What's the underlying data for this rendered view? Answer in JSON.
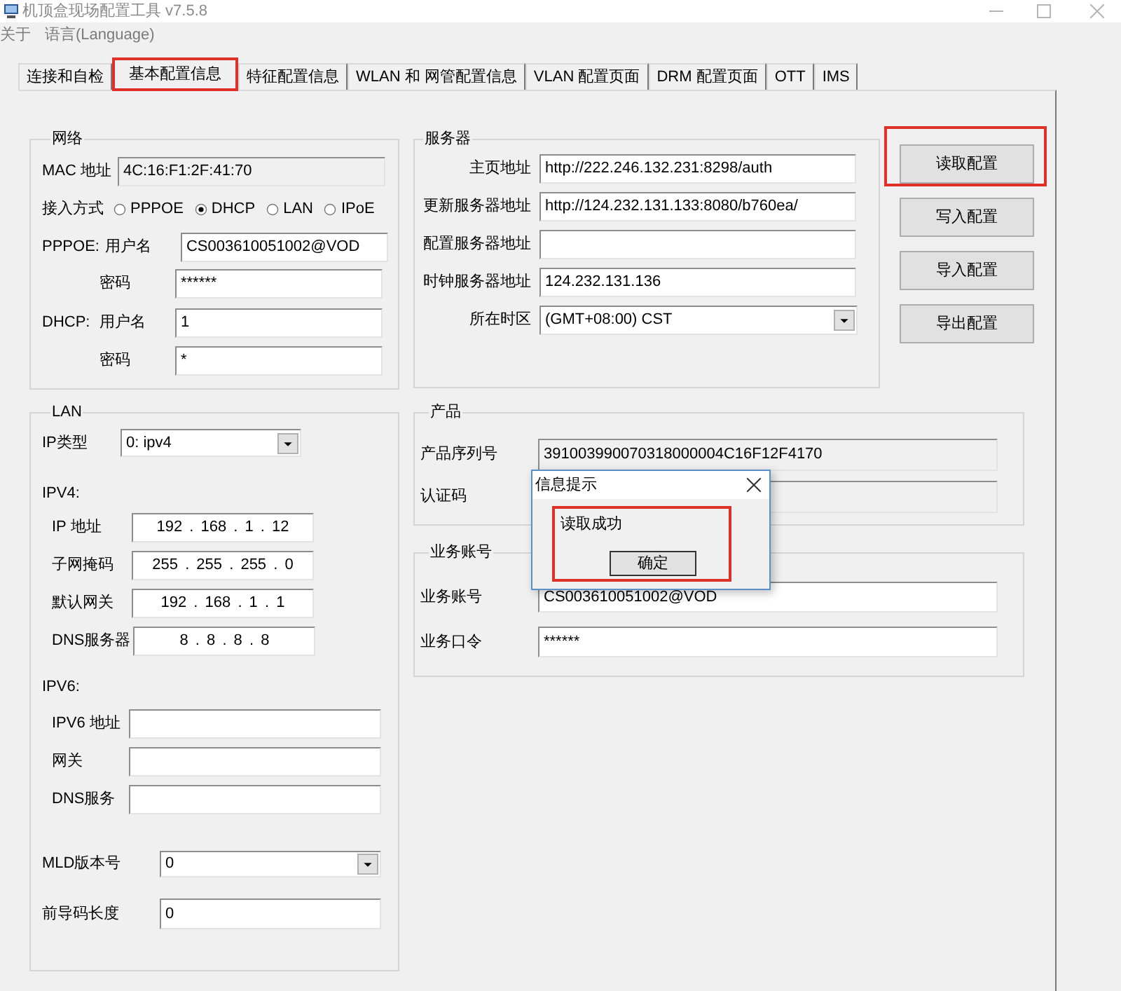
{
  "window": {
    "title": "机顶盒现场配置工具 v7.5.8"
  },
  "menu": [
    "关于",
    "语言(Language)"
  ],
  "tabs": [
    {
      "label": "连接和自检",
      "selected": false,
      "highlighted": false
    },
    {
      "label": "基本配置信息",
      "selected": true,
      "highlighted": true
    },
    {
      "label": "特征配置信息",
      "selected": false,
      "highlighted": false
    },
    {
      "label": "WLAN 和 网管配置信息",
      "selected": false,
      "highlighted": false
    },
    {
      "label": "VLAN 配置页面",
      "selected": false,
      "highlighted": false
    },
    {
      "label": "DRM 配置页面",
      "selected": false,
      "highlighted": false
    },
    {
      "label": "OTT",
      "selected": false,
      "highlighted": false
    },
    {
      "label": "IMS",
      "selected": false,
      "highlighted": false
    }
  ],
  "network": {
    "title": "网络",
    "mac_label": "MAC 地址",
    "mac": "4C:16:F1:2F:41:70",
    "access_label": "接入方式",
    "access_options": [
      {
        "label": "PPPOE",
        "selected": false
      },
      {
        "label": "DHCP",
        "selected": true
      },
      {
        "label": "LAN",
        "selected": false
      },
      {
        "label": "IPoE",
        "selected": false
      }
    ],
    "pppoe": {
      "label": "PPPOE:",
      "username_label": "用户名",
      "username": "CS003610051002@VOD",
      "password_label": "密码",
      "password": "******"
    },
    "dhcp": {
      "label": "DHCP:",
      "username_label": "用户名",
      "username": "1",
      "password_label": "密码",
      "password": "*"
    }
  },
  "server": {
    "title": "服务器",
    "fields": [
      {
        "label": "主页地址",
        "kind": "text",
        "value": "http://222.246.132.231:8298/auth"
      },
      {
        "label": "更新服务器地址",
        "kind": "text",
        "value": "http://124.232.131.133:8080/b760ea/"
      },
      {
        "label": "配置服务器地址",
        "kind": "text"
      },
      {
        "label": "时钟服务器地址",
        "kind": "text",
        "value": "124.232.131.136"
      },
      {
        "label": "所在时区",
        "kind": "dropdown",
        "value": "(GMT+08:00) CST"
      }
    ]
  },
  "actions": [
    {
      "label": "读取配置",
      "highlighted": true
    },
    {
      "label": "写入配置",
      "highlighted": false
    },
    {
      "label": "导入配置",
      "highlighted": false
    },
    {
      "label": "导出配置",
      "highlighted": false
    }
  ],
  "lan": {
    "title": "LAN",
    "ip_type_label": "IP类型",
    "ip_type": "0: ipv4",
    "ipv4_label": "IPV4:",
    "ipv4": [
      {
        "label": "IP 地址",
        "value": "192 . 168 . 1 . 12"
      },
      {
        "label": "子网掩码",
        "value": "255 . 255 . 255 . 0"
      },
      {
        "label": "默认网关",
        "value": "192 . 168 . 1 . 1"
      },
      {
        "label": "DNS服务器",
        "value": "8 . 8 . 8 . 8"
      }
    ],
    "ipv6_label": "IPV6:",
    "ipv6": [
      {
        "label": "IPV6 地址"
      },
      {
        "label": "网关"
      },
      {
        "label": "DNS服务"
      }
    ],
    "mld_label": "MLD版本号",
    "mld": "0",
    "prefix_label": "前导码长度",
    "prefix": "0"
  },
  "product": {
    "title": "产品",
    "fields": [
      {
        "label": "产品序列号",
        "value": "391003990070318000004C16F12F4170"
      },
      {
        "label": "认证码"
      }
    ]
  },
  "account": {
    "title": "业务账号",
    "fields": [
      {
        "label": "业务账号",
        "value": "CS003610051002@VOD"
      },
      {
        "label": "业务口令",
        "value": "******"
      }
    ]
  },
  "dialog": {
    "title": "信息提示",
    "message": "读取成功",
    "button": "确定",
    "highlighted": true
  }
}
